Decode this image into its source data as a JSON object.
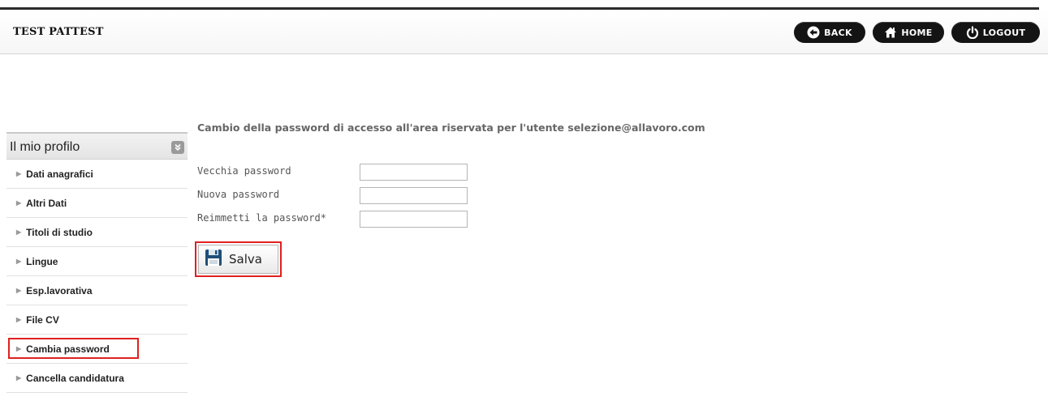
{
  "header": {
    "title": "TEST PATTEST",
    "buttons": {
      "back": "BACK",
      "home": "HOME",
      "logout": "LOGOUT"
    }
  },
  "sidebar": {
    "title": "Il mio profilo",
    "items": [
      {
        "label": "Dati anagrafici"
      },
      {
        "label": "Altri Dati"
      },
      {
        "label": "Titoli di studio"
      },
      {
        "label": "Lingue"
      },
      {
        "label": "Esp.lavorativa"
      },
      {
        "label": "File CV"
      },
      {
        "label": "Cambia password",
        "highlighted": true
      },
      {
        "label": "Cancella candidatura"
      }
    ]
  },
  "main": {
    "title": "Cambio della password di accesso all'area riservata per l'utente selezione@allavoro.com",
    "fields": [
      {
        "label": "Vecchia password",
        "value": ""
      },
      {
        "label": "Nuova password",
        "value": ""
      },
      {
        "label": "Reimmetti la password*",
        "value": ""
      }
    ],
    "save_label": "Salva"
  },
  "colors": {
    "header_button_bg": "#141414",
    "highlight_border": "#e02020",
    "sidebar_header_bg": "#e8e8e8"
  },
  "icons": {
    "back": "arrow-left-icon",
    "home": "home-icon",
    "logout": "power-icon",
    "collapse": "double-chevron-down-icon",
    "save": "floppy-disk-icon",
    "sidebar_bullet": "triangle-right-icon"
  }
}
